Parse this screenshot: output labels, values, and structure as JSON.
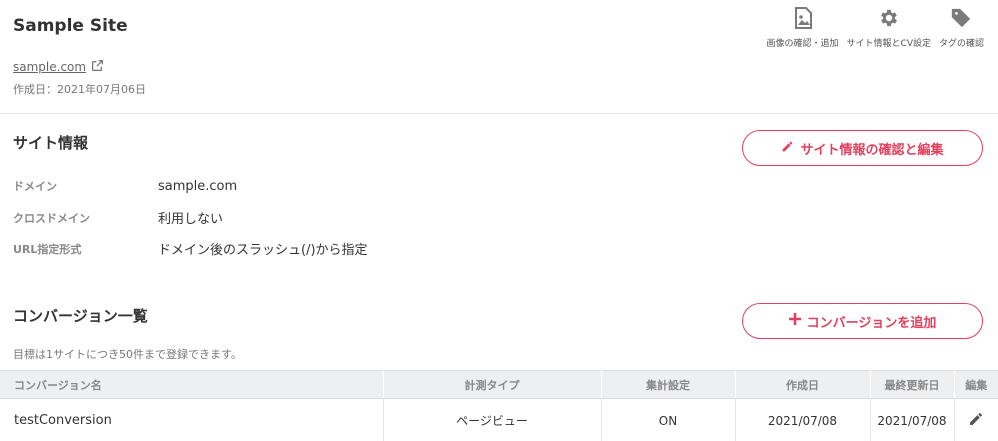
{
  "site": {
    "title": "Sample Site",
    "link_text": "sample.com",
    "created": "作成日：2021年07月06日"
  },
  "top_actions": [
    {
      "label": "画像の確認・追加",
      "icon": "image-file-icon"
    },
    {
      "label": "サイト情報とCV設定",
      "icon": "gear-icon"
    },
    {
      "label": "タグの確認",
      "icon": "tag-icon"
    }
  ],
  "site_info": {
    "title": "サイト情報",
    "edit_button": "サイト情報の確認と編集",
    "rows": [
      {
        "key": "ドメイン",
        "value": "sample.com"
      },
      {
        "key": "クロスドメイン",
        "value": "利用しない"
      },
      {
        "key": "URL指定形式",
        "value": "ドメイン後のスラッシュ(/)から指定"
      }
    ]
  },
  "conversions": {
    "title": "コンバージョン一覧",
    "add_button": "コンバージョンを追加",
    "note": "目標は1サイトにつき50件まで登録できます。",
    "headers": [
      "コンバージョン名",
      "計測タイプ",
      "集計設定",
      "作成日",
      "最終更新日",
      "編集"
    ],
    "rows": [
      {
        "name": "testConversion",
        "type": "ページビュー",
        "setting": "ON",
        "created": "2021/07/08",
        "updated": "2021/07/08"
      }
    ]
  },
  "colors": {
    "accent": "#e2405f",
    "icon_gray": "#7a7a7a",
    "header_bg": "#eeeff1"
  }
}
